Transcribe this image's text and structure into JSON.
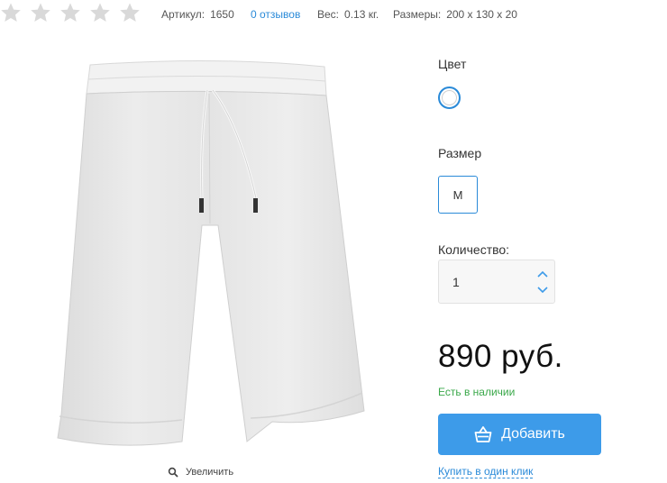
{
  "meta": {
    "rating": 0,
    "rating_max": 5,
    "sku_label": "Артикул:",
    "sku_value": "1650",
    "reviews_link": "0 отзывов",
    "weight_label": "Вес:",
    "weight_value": "0.13 кг.",
    "size_label": "Размеры:",
    "size_value": "200 x 130 x 20"
  },
  "product": {
    "zoom_label": "Увеличить",
    "color_label": "Цвет",
    "size_option_label": "Размер",
    "size_selected": "M",
    "quantity_label": "Количество:",
    "quantity_value": "1",
    "price": "890 руб.",
    "stock_status": "Есть в наличии",
    "add_button": "Добавить",
    "one_click": "Купить в один клик"
  },
  "colors": {
    "accent": "#2a8ad8",
    "button": "#3d9be9",
    "in_stock": "#3aa84a",
    "star_empty": "#d9d9d9",
    "swatch": "#ffffff"
  },
  "icons": {
    "rating": "star-icon",
    "zoom": "magnifier-icon",
    "qty_up": "chevron-up-icon",
    "qty_down": "chevron-down-icon",
    "cart": "basket-icon"
  }
}
